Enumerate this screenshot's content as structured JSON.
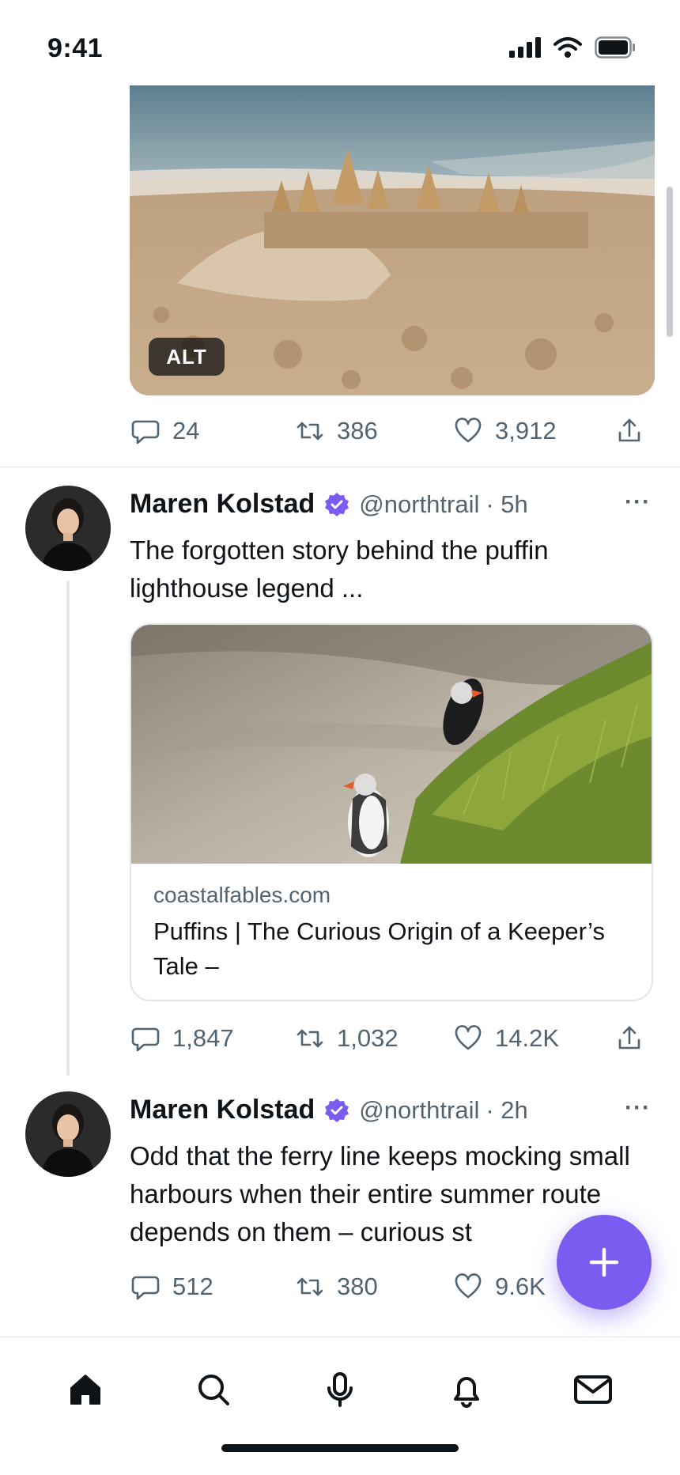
{
  "status_bar": {
    "time": "9:41"
  },
  "post1": {
    "alt_badge": "ALT",
    "replies": "24",
    "reposts": "386",
    "likes": "3,912"
  },
  "post2": {
    "name": "Maren Kolstad",
    "handle": "@northtrail",
    "time": "· 5h",
    "text": "The forgotten story behind the puffin lighthouse legend ...",
    "card_domain": "coastalfables.com",
    "card_title": "Puffins | The Curious Origin of a Keeper’s Tale –",
    "replies": "1,847",
    "reposts": "1,032",
    "likes": "14.2K"
  },
  "post3": {
    "name": "Maren Kolstad",
    "handle": "@northtrail",
    "time": "· 2h",
    "text": "Odd that the ferry line keeps mocking small harbours when their entire summer route depends on them – curious st",
    "replies": "512",
    "reposts": "380",
    "likes": "9.6K"
  },
  "more_label": "···",
  "colors": {
    "accent": "#7b5cf0",
    "verified": "#7b5cf0",
    "text": "#0f1419",
    "muted": "#536471"
  },
  "tabs": [
    "home-icon",
    "search-icon",
    "microphone-icon",
    "bell-icon",
    "mail-icon"
  ]
}
